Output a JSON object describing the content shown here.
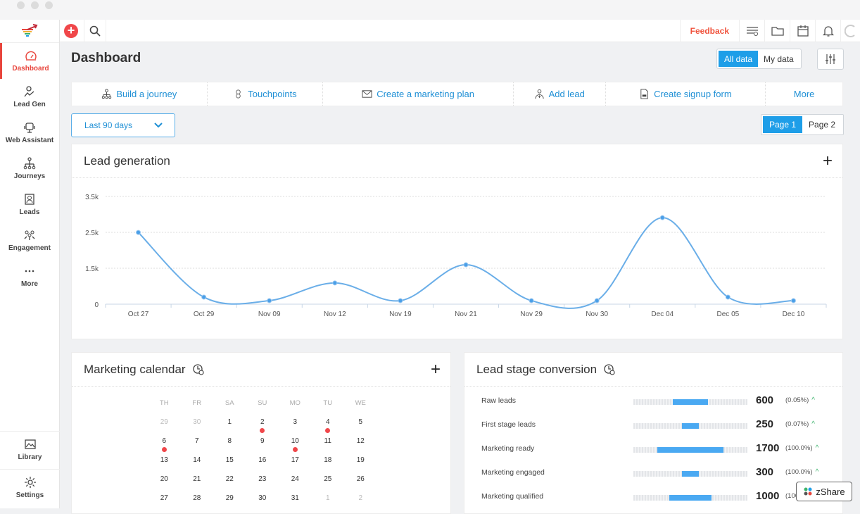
{
  "app": {
    "accent": "#1e9ee8",
    "brand_red": "#e8453c"
  },
  "topbar": {
    "feedback_label": "Feedback"
  },
  "sidebar": {
    "items": [
      {
        "label": "Dashboard",
        "icon": "gauge-icon",
        "active": true
      },
      {
        "label": "Lead Gen",
        "icon": "lead-gen-icon"
      },
      {
        "label": "Web Assistant",
        "icon": "web-assistant-icon"
      },
      {
        "label": "Journeys",
        "icon": "journeys-icon"
      },
      {
        "label": "Leads",
        "icon": "leads-icon"
      },
      {
        "label": "Engagement",
        "icon": "engagement-icon"
      },
      {
        "label": "More",
        "icon": "more-icon"
      }
    ],
    "bottom": [
      {
        "label": "Library",
        "icon": "image-icon"
      },
      {
        "label": "Settings",
        "icon": "gear-icon"
      }
    ]
  },
  "header": {
    "title": "Dashboard",
    "toggle": {
      "all": "All data",
      "mine": "My data",
      "selected": "All data"
    }
  },
  "quick_actions": [
    {
      "label": "Build a journey",
      "icon": "journey-icon"
    },
    {
      "label": "Touchpoints",
      "icon": "touchpoint-icon"
    },
    {
      "label": "Create a marketing plan",
      "icon": "envelope-icon"
    },
    {
      "label": "Add lead",
      "icon": "add-user-icon"
    },
    {
      "label": "Create signup form",
      "icon": "form-icon"
    },
    {
      "label": "More",
      "icon": ""
    }
  ],
  "range": {
    "selected": "Last 90 days"
  },
  "pager": {
    "page1": "Page 1",
    "page2": "Page 2",
    "selected": "Page 1"
  },
  "lead_generation": {
    "title": "Lead generation"
  },
  "chart_data": {
    "type": "line",
    "title": "Lead generation",
    "xlabel": "",
    "ylabel": "",
    "categories": [
      "Oct 27",
      "Oct 29",
      "Nov 09",
      "Nov 12",
      "Nov 19",
      "Nov 21",
      "Nov 29",
      "Nov 30",
      "Dec 04",
      "Dec 05",
      "Dec 10"
    ],
    "series": [
      {
        "name": "Leads",
        "values": [
          2330,
          230,
          115,
          690,
          115,
          1280,
          115,
          115,
          2810,
          230,
          115
        ],
        "color": "#6aaee8"
      }
    ],
    "yticks": [
      "0",
      "1.5k",
      "2.5k",
      "3.5k"
    ],
    "ylim": [
      0,
      3500
    ],
    "grid": true,
    "smooth": true
  },
  "calendar": {
    "title": "Marketing calendar",
    "weekdays": [
      "TH",
      "FR",
      "SA",
      "SU",
      "MO",
      "TU",
      "WE"
    ],
    "weeks": [
      [
        {
          "d": "29",
          "m": true
        },
        {
          "d": "30",
          "m": true
        },
        {
          "d": "1"
        },
        {
          "d": "2",
          "e": true
        },
        {
          "d": "3"
        },
        {
          "d": "4",
          "e": true
        },
        {
          "d": "5"
        }
      ],
      [
        {
          "d": "6",
          "e": true
        },
        {
          "d": "7"
        },
        {
          "d": "8"
        },
        {
          "d": "9"
        },
        {
          "d": "10",
          "e": true
        },
        {
          "d": "11"
        },
        {
          "d": "12"
        }
      ],
      [
        {
          "d": "13"
        },
        {
          "d": "14"
        },
        {
          "d": "15"
        },
        {
          "d": "16"
        },
        {
          "d": "17"
        },
        {
          "d": "18"
        },
        {
          "d": "19"
        }
      ],
      [
        {
          "d": "20"
        },
        {
          "d": "21"
        },
        {
          "d": "22"
        },
        {
          "d": "23"
        },
        {
          "d": "24"
        },
        {
          "d": "25"
        },
        {
          "d": "26"
        }
      ],
      [
        {
          "d": "27"
        },
        {
          "d": "28"
        },
        {
          "d": "29"
        },
        {
          "d": "30"
        },
        {
          "d": "31"
        },
        {
          "d": "1",
          "m": true
        },
        {
          "d": "2",
          "m": true
        }
      ]
    ]
  },
  "lead_stage": {
    "title": "Lead stage conversion",
    "rows": [
      {
        "label": "Raw leads",
        "value": "600",
        "pct": "(0.05%)",
        "fill": 0.31
      },
      {
        "label": "First stage leads",
        "value": "250",
        "pct": "(0.07%)",
        "fill": 0.15
      },
      {
        "label": "Marketing ready",
        "value": "1700",
        "pct": "(100.0%)",
        "fill": 0.58
      },
      {
        "label": "Marketing engaged",
        "value": "300",
        "pct": "(100.0%)",
        "fill": 0.15
      },
      {
        "label": "Marketing qualified",
        "value": "1000",
        "pct": "(100.0%)",
        "fill": 0.37
      }
    ]
  },
  "zshare": {
    "label": "zShare"
  }
}
